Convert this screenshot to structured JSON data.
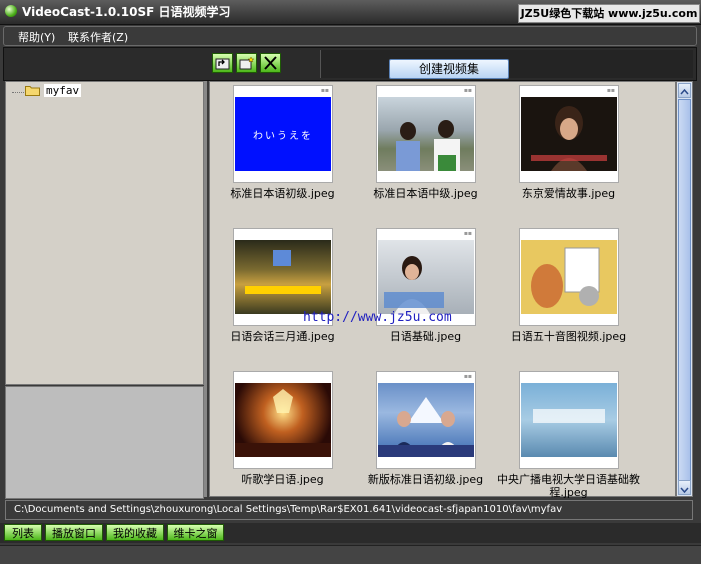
{
  "window": {
    "title": "VideoCast-1.0.10SF 日语视频学习",
    "brand": "JZ5U绿色下载站 www.jz5u.com"
  },
  "menu": [
    {
      "label": "帮助(Y)"
    },
    {
      "label": "联系作者(Z)"
    }
  ],
  "toolbar": {
    "create_label": "创建视频集"
  },
  "tree": {
    "items": [
      {
        "label": "myfav"
      }
    ]
  },
  "files": [
    {
      "caption": "标准日本语初级.jpeg",
      "thumb_text": "わいうえを"
    },
    {
      "caption": "标准日本语中级.jpeg"
    },
    {
      "caption": "东京爱情故事.jpeg"
    },
    {
      "caption": "日语会话三月通.jpeg"
    },
    {
      "caption": "日语基础.jpeg"
    },
    {
      "caption": "日语五十音图视频.jpeg"
    },
    {
      "caption": "听歌学日语.jpeg"
    },
    {
      "caption": "新版标准日语初级.jpeg"
    },
    {
      "caption": "中央广播电视大学日语基础教程.jpeg"
    }
  ],
  "watermark": "http://www.jz5u.com",
  "path": "C:\\Documents and Settings\\zhouxurong\\Local Settings\\Temp\\Rar$EX01.641\\videocast-sfjapan1010\\fav\\myfav",
  "tabs": [
    {
      "label": "列表"
    },
    {
      "label": "播放窗口"
    },
    {
      "label": "我的收藏"
    },
    {
      "label": "维卡之窗"
    }
  ],
  "colors": {
    "accent_green": "#4db81a",
    "chrome_dark": "#3a3a3a",
    "panel_bg": "#d4d0c8",
    "button_blue": "#b9d4f4"
  }
}
